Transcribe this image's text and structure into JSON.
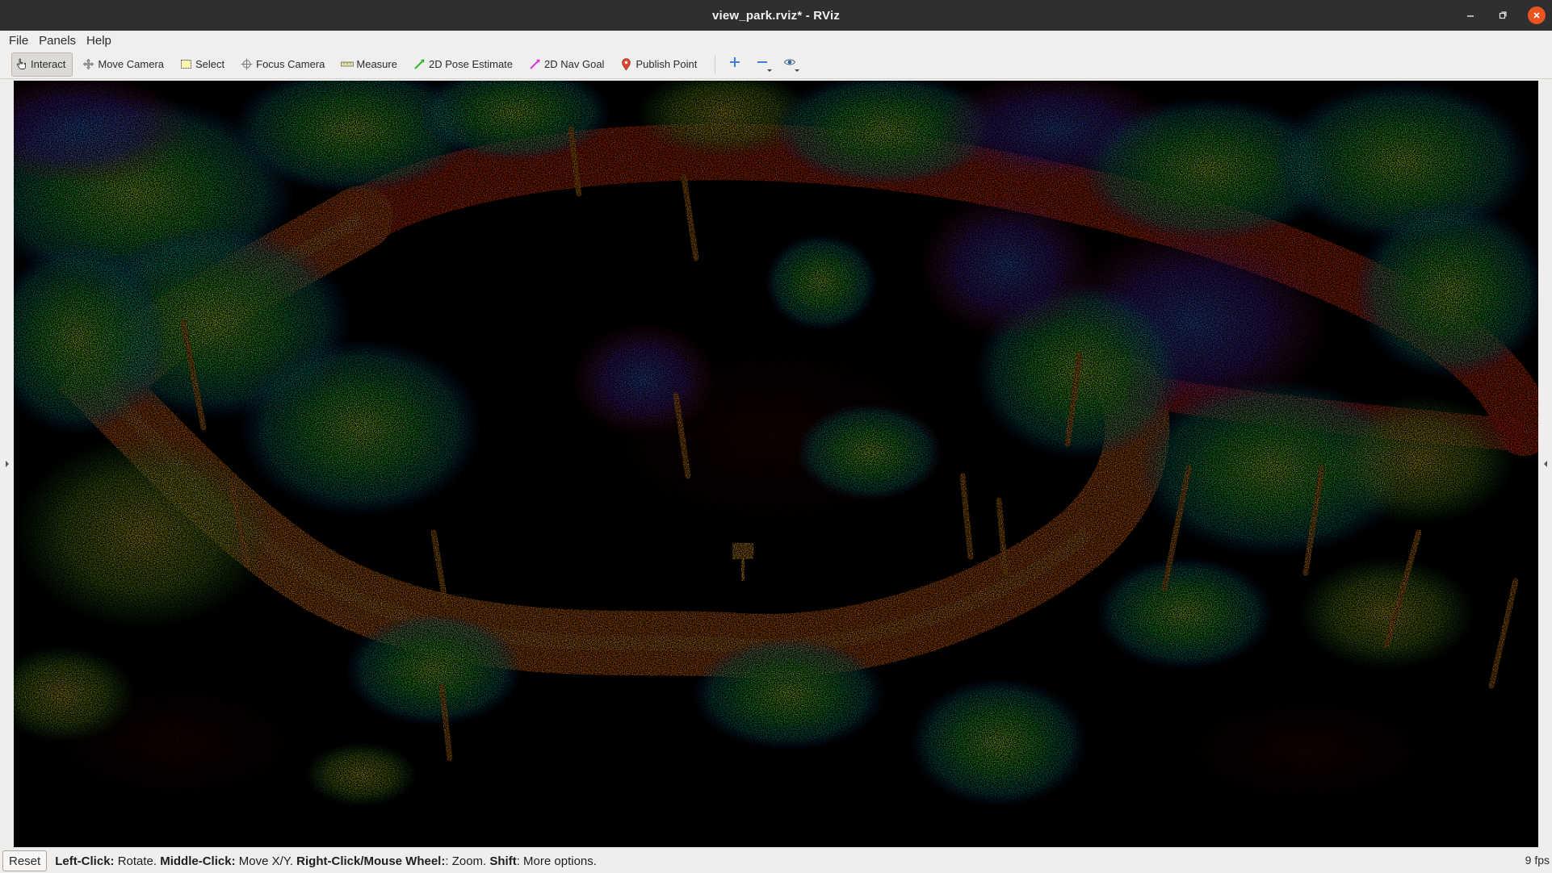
{
  "window": {
    "title": "view_park.rviz* - RViz"
  },
  "menu": {
    "items": [
      "File",
      "Panels",
      "Help"
    ]
  },
  "toolbar": {
    "tools": [
      {
        "label": "Interact",
        "icon": "hand-cursor-icon",
        "active": true
      },
      {
        "label": "Move Camera",
        "icon": "move-camera-icon"
      },
      {
        "label": "Select",
        "icon": "select-box-icon"
      },
      {
        "label": "Focus Camera",
        "icon": "focus-camera-icon"
      },
      {
        "label": "Measure",
        "icon": "ruler-icon"
      },
      {
        "label": "2D Pose Estimate",
        "icon": "pose-estimate-arrow-icon",
        "color": "#2eb82e"
      },
      {
        "label": "2D Nav Goal",
        "icon": "nav-goal-arrow-icon",
        "color": "#d936d9"
      },
      {
        "label": "Publish Point",
        "icon": "map-pin-icon",
        "color": "#d9452e"
      }
    ],
    "extra_icons": [
      "add-tool-icon",
      "remove-tool-icon",
      "tool-visibility-eye-icon"
    ]
  },
  "statusbar": {
    "reset_label": "Reset",
    "hint_parts": [
      {
        "bold": "Left-Click:",
        "text": " Rotate. "
      },
      {
        "bold": "Middle-Click:",
        "text": " Move X/Y. "
      },
      {
        "bold": "Right-Click/Mouse Wheel:",
        "text": ": Zoom. "
      },
      {
        "bold": "Shift",
        "text": ": More options."
      }
    ],
    "fps": "9 fps"
  },
  "viewport": {
    "content": "3D point cloud, height-colored"
  },
  "colors": {
    "titlebar": "#2f2f2f",
    "close_button": "#e95420",
    "viewport_background": "#000000",
    "path_orange": "#ff7a1a",
    "path_red": "#ff3b1a",
    "foliage_green": "#3fe03a",
    "foliage_blue": "#2a6bff"
  }
}
